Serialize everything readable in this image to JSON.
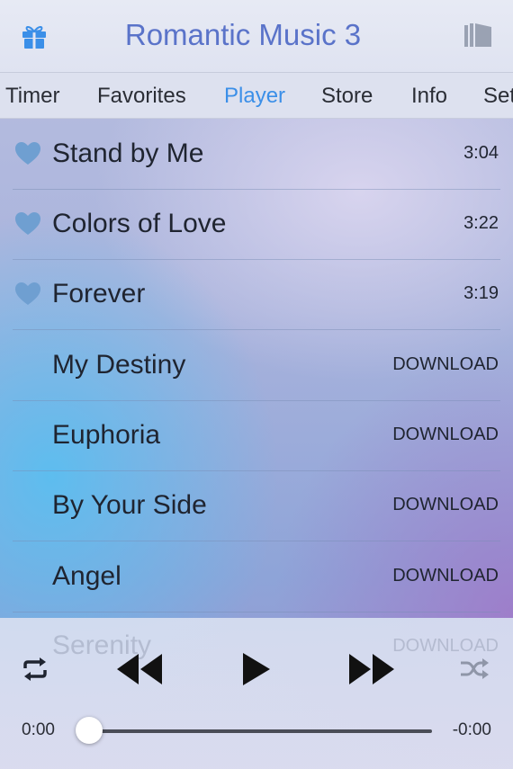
{
  "header": {
    "title": "Romantic Music 3",
    "icons": {
      "left": "gift-icon",
      "right": "book-icon"
    },
    "accent": "#3b8fe8"
  },
  "tabs": [
    {
      "label": "Timer",
      "active": false
    },
    {
      "label": "Favorites",
      "active": false
    },
    {
      "label": "Player",
      "active": true
    },
    {
      "label": "Store",
      "active": false
    },
    {
      "label": "Info",
      "active": false
    },
    {
      "label": "Set",
      "active": false
    }
  ],
  "songs": [
    {
      "title": "Stand by Me",
      "meta": "3:04",
      "favorite": true
    },
    {
      "title": "Colors of Love",
      "meta": "3:22",
      "favorite": true
    },
    {
      "title": "Forever",
      "meta": "3:19",
      "favorite": true
    },
    {
      "title": "My Destiny",
      "meta": "DOWNLOAD",
      "favorite": false
    },
    {
      "title": "Euphoria",
      "meta": "DOWNLOAD",
      "favorite": false
    },
    {
      "title": "By Your Side",
      "meta": "DOWNLOAD",
      "favorite": false
    },
    {
      "title": "Angel",
      "meta": "DOWNLOAD",
      "favorite": false
    }
  ],
  "player": {
    "behind_title": "Serenity",
    "behind_meta": "DOWNLOAD",
    "elapsed": "0:00",
    "remaining": "-0:00",
    "progress": 0,
    "controls": [
      "repeat-icon",
      "rewind-icon",
      "play-icon",
      "fast-forward-icon",
      "shuffle-icon"
    ]
  }
}
